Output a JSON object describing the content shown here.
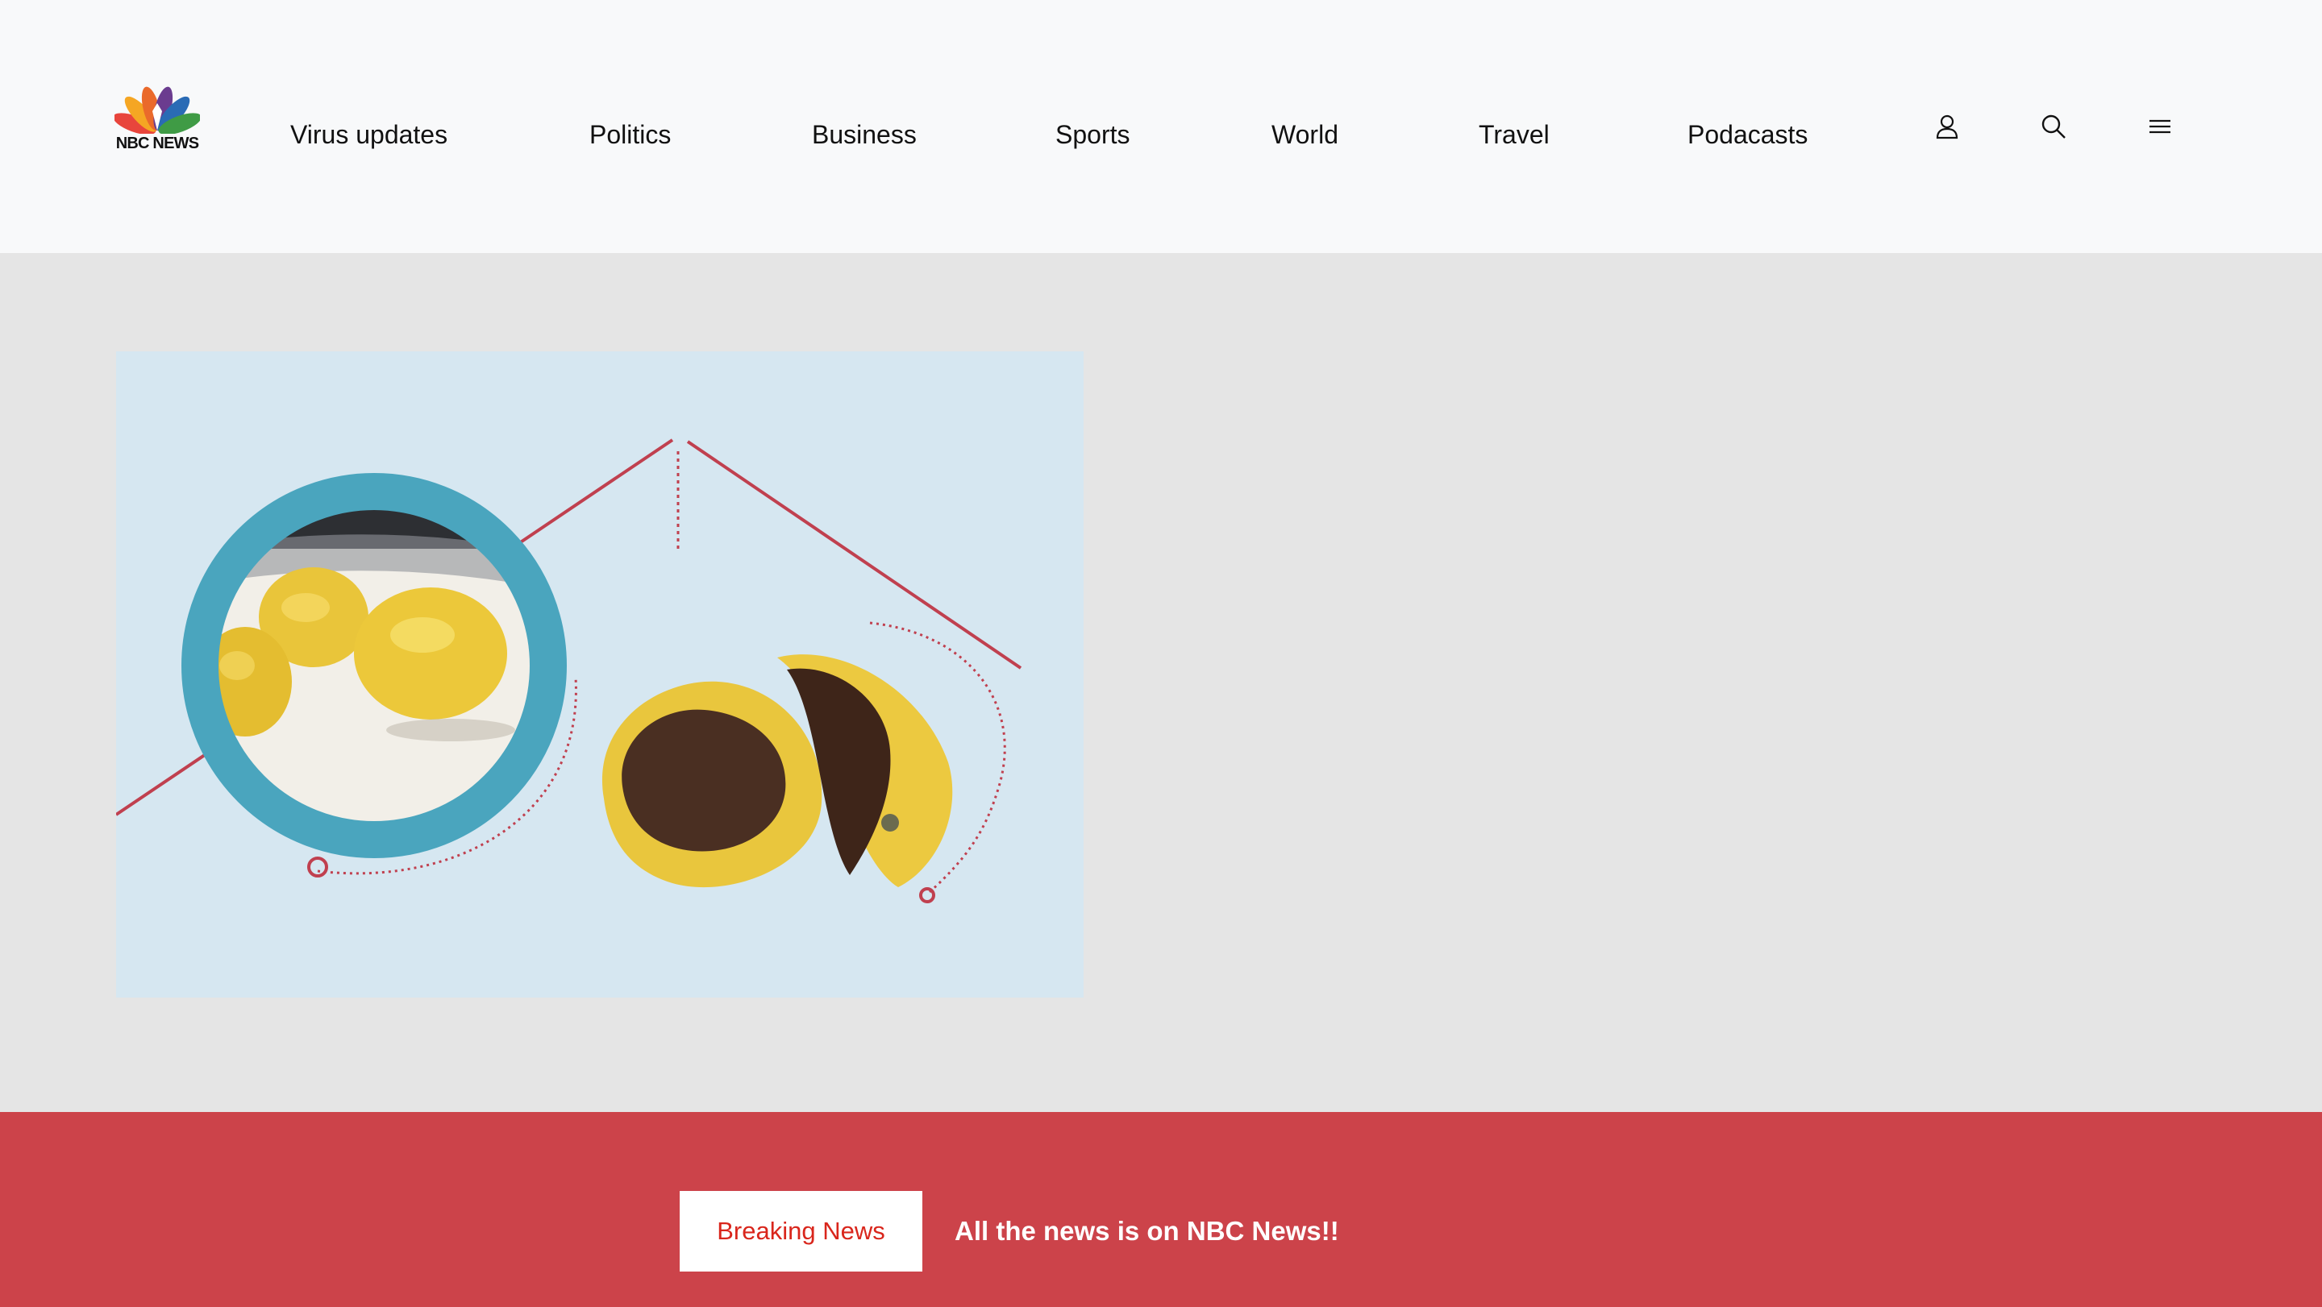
{
  "header": {
    "logo_text": "NBC NEWS",
    "nav": [
      "Virus updates",
      "Politics",
      "Business",
      "Sports",
      "World",
      "Travel",
      "Podacasts"
    ],
    "icons": [
      "user-icon",
      "search-icon",
      "menu-icon"
    ]
  },
  "hero": {
    "image": "lemons-illustration"
  },
  "banner": {
    "button_label": "Breaking News",
    "message": "All the news is on NBC News!!"
  },
  "colors": {
    "header_bg": "#f8f9fa",
    "page_bg": "#e5e5e5",
    "hero_bg": "#d6e7f1",
    "banner_bg": "#cc434a",
    "breaking_text": "#d9261c",
    "ring": "#4aa5be",
    "line_red": "#c0404f"
  }
}
